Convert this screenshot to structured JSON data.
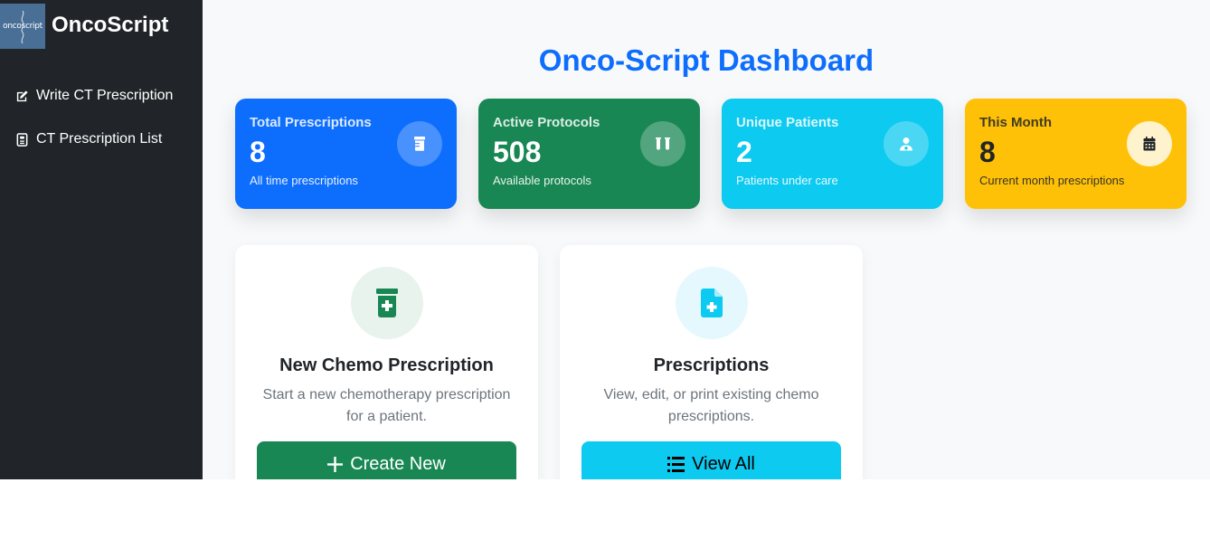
{
  "brand": {
    "name": "OncoScript",
    "logo_text": "oncoscript"
  },
  "sidebar": {
    "items": [
      {
        "label": "Write CT Prescription",
        "icon": "pencil-square-icon"
      },
      {
        "label": "CT Prescription List",
        "icon": "file-list-icon"
      }
    ]
  },
  "page": {
    "title": "Onco-Script Dashboard"
  },
  "stats": [
    {
      "label": "Total Prescriptions",
      "value": "8",
      "sub": "All time prescriptions",
      "icon": "prescription-bottle-icon",
      "color": "#0d6efd"
    },
    {
      "label": "Active Protocols",
      "value": "508",
      "sub": "Available protocols",
      "icon": "vials-icon",
      "color": "#198754"
    },
    {
      "label": "Unique Patients",
      "value": "2",
      "sub": "Patients under care",
      "icon": "user-doctor-icon",
      "color": "#0dcaf0"
    },
    {
      "label": "This Month",
      "value": "8",
      "sub": "Current month prescriptions",
      "icon": "calendar-icon",
      "color": "#ffc107"
    }
  ],
  "actions": [
    {
      "title": "New Chemo Prescription",
      "desc": "Start a new chemotherapy prescription for a patient.",
      "button": "Create New",
      "icon": "prescription-bottle-medical-icon",
      "button_icon": "plus-icon",
      "color": "#198754"
    },
    {
      "title": "Prescriptions",
      "desc": "View, edit, or print existing chemo prescriptions.",
      "button": "View All",
      "icon": "file-medical-icon",
      "button_icon": "list-icon",
      "color": "#0dcaf0"
    }
  ]
}
